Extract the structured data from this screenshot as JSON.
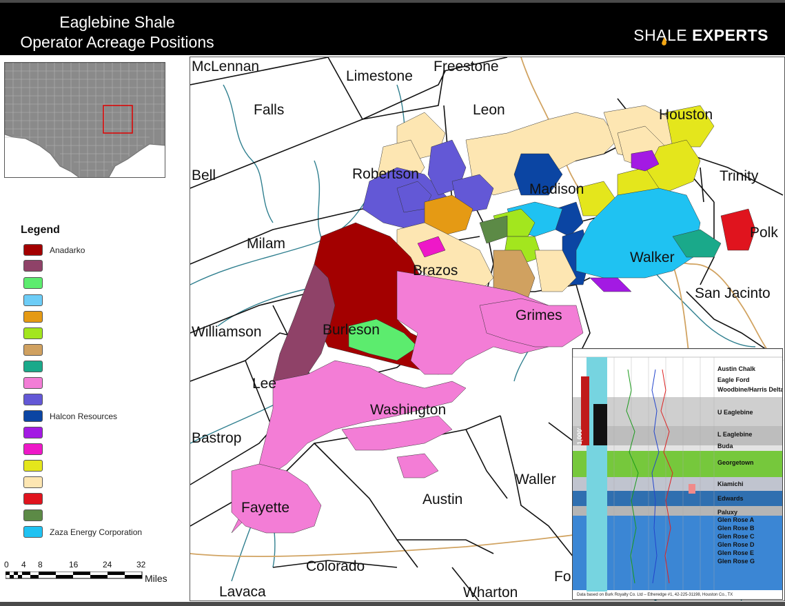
{
  "header": {
    "title_line1": "Eaglebine Shale",
    "title_line2": "Operator Acreage Positions",
    "brand_part1": "SHALE",
    "brand_part2": "EXPERTS"
  },
  "legend": {
    "title": "Legend",
    "items": [
      {
        "label": "Anadarko",
        "color": "#a30000"
      },
      {
        "label": "",
        "color": "#8f4268"
      },
      {
        "label": "",
        "color": "#5cec6e"
      },
      {
        "label": "",
        "color": "#6dcdf7"
      },
      {
        "label": "",
        "color": "#e59a14"
      },
      {
        "label": "",
        "color": "#a3e61e"
      },
      {
        "label": "",
        "color": "#d0a160"
      },
      {
        "label": "",
        "color": "#1aa98a"
      },
      {
        "label": "",
        "color": "#f37dd6"
      },
      {
        "label": "",
        "color": "#6358d6"
      },
      {
        "label": "Halcon Resources",
        "color": "#0b45a3"
      },
      {
        "label": "",
        "color": "#a31ae3"
      },
      {
        "label": "",
        "color": "#ee18c8"
      },
      {
        "label": "",
        "color": "#e4e61c"
      },
      {
        "label": "",
        "color": "#fde6b2"
      },
      {
        "label": "",
        "color": "#e0141e"
      },
      {
        "label": "",
        "color": "#5c8a46"
      },
      {
        "label": "Zaza Energy Corporation",
        "color": "#1fc2f2"
      }
    ]
  },
  "scale_bar": {
    "ticks": [
      "0",
      "4",
      "8",
      "16",
      "24",
      "32"
    ],
    "unit": "Miles"
  },
  "map": {
    "counties": [
      {
        "name": "McLennan"
      },
      {
        "name": "Limestone"
      },
      {
        "name": "Freestone"
      },
      {
        "name": "Falls"
      },
      {
        "name": "Leon"
      },
      {
        "name": "Houston"
      },
      {
        "name": "Bell"
      },
      {
        "name": "Robertson"
      },
      {
        "name": "Madison"
      },
      {
        "name": "Trinity"
      },
      {
        "name": "Milam"
      },
      {
        "name": "Brazos"
      },
      {
        "name": "Polk"
      },
      {
        "name": "Walker"
      },
      {
        "name": "San Jacinto"
      },
      {
        "name": "Williamson"
      },
      {
        "name": "Burleson"
      },
      {
        "name": "Grimes"
      },
      {
        "name": "Lee"
      },
      {
        "name": "Washington"
      },
      {
        "name": "Bastrop"
      },
      {
        "name": "Waller"
      },
      {
        "name": "Austin"
      },
      {
        "name": "Fayette"
      },
      {
        "name": "Colorado"
      },
      {
        "name": "Fo"
      },
      {
        "name": "Lavaca"
      },
      {
        "name": "Wharton"
      }
    ]
  },
  "type_log": {
    "thickness_label": "1,000'",
    "formations": [
      {
        "name": "Austin Chalk"
      },
      {
        "name": "Eagle Ford"
      },
      {
        "name": "Woodbine/Harris Delta"
      },
      {
        "name": "U Eaglebine"
      },
      {
        "name": "L Eaglebine"
      },
      {
        "name": "Buda"
      },
      {
        "name": "Georgetown"
      },
      {
        "name": "Kiamichi"
      },
      {
        "name": "Edwards"
      },
      {
        "name": "Paluxy"
      },
      {
        "name": "Glen Rose A"
      },
      {
        "name": "Glen Rose B"
      },
      {
        "name": "Glen Rose C"
      },
      {
        "name": "Glen Rose D"
      },
      {
        "name": "Glen Rose E"
      },
      {
        "name": "Glen Rose G"
      }
    ],
    "note": "Data based on Burk Royalty Co. Ltd – Etheredge #1, 42-225-31198, Houston Co., TX"
  }
}
